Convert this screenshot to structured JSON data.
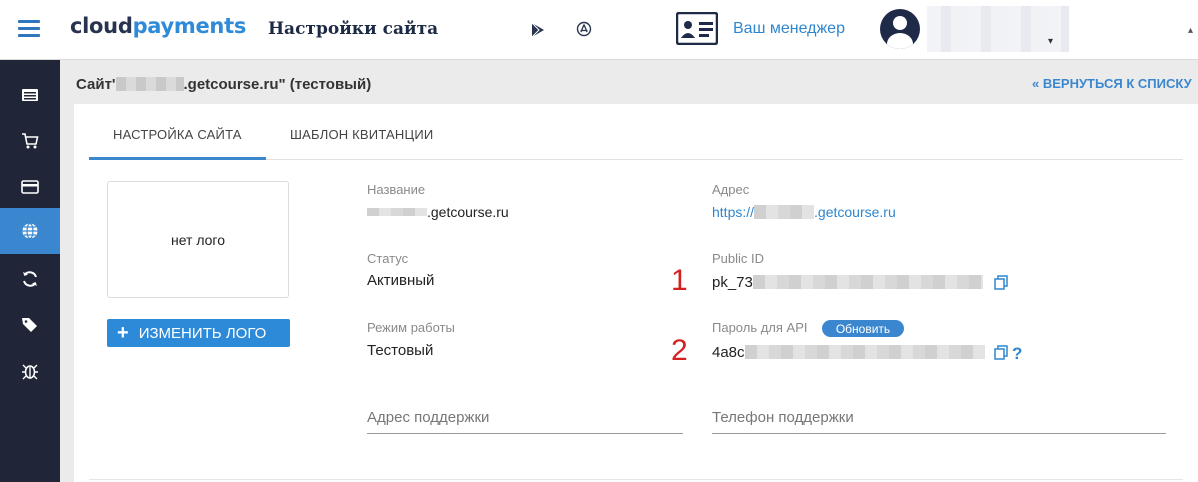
{
  "header": {
    "logo_part1": "cloud",
    "logo_part2": "payments",
    "page_title": "Настройки сайта",
    "manager_link": "Ваш менеджер",
    "user_chevron": "▾",
    "scroll_chevron": "▴"
  },
  "sidebar": {
    "items": [
      {
        "icon": "list-icon",
        "active": false
      },
      {
        "icon": "cart-icon",
        "active": false
      },
      {
        "icon": "card-icon",
        "active": false
      },
      {
        "icon": "globe-icon",
        "active": true
      },
      {
        "icon": "refresh-icon",
        "active": false
      },
      {
        "icon": "tags-icon",
        "active": false
      },
      {
        "icon": "bug-icon",
        "active": false
      }
    ]
  },
  "site": {
    "title_prefix": "Сайт'",
    "title_suffix": ".getcourse.ru\" (тестовый)",
    "back_link": "« ВЕРНУТЬСЯ К СПИСКУ"
  },
  "tabs": [
    {
      "label": "НАСТРОЙКА САЙТА",
      "active": true
    },
    {
      "label": "ШАБЛОН КВИТАНЦИИ",
      "active": false
    }
  ],
  "logo_panel": {
    "placeholder": "нет лого",
    "button_label": "ИЗМЕНИТЬ ЛОГО",
    "button_plus": "+"
  },
  "fields": {
    "name_label": "Название",
    "name_value_suffix": ".getcourse.ru",
    "address_label": "Адрес",
    "address_value_prefix": "https://",
    "address_value_suffix": ".getcourse.ru",
    "status_label": "Статус",
    "status_value": "Активный",
    "public_id_label": "Public ID",
    "public_id_value_prefix": "pk_73",
    "mode_label": "Режим работы",
    "mode_value": "Тестовый",
    "api_password_label": "Пароль для API",
    "api_password_value_prefix": "4a8c",
    "refresh_button": "Обновить",
    "help_mark": "?",
    "support_address_placeholder": "Адрес поддержки",
    "support_phone_placeholder": "Телефон поддержки"
  },
  "annotations": {
    "marker_1": "1",
    "marker_2": "2"
  },
  "colors": {
    "accent": "#3b87cf",
    "sidebar_bg": "#202638",
    "annotation": "#d32020"
  }
}
